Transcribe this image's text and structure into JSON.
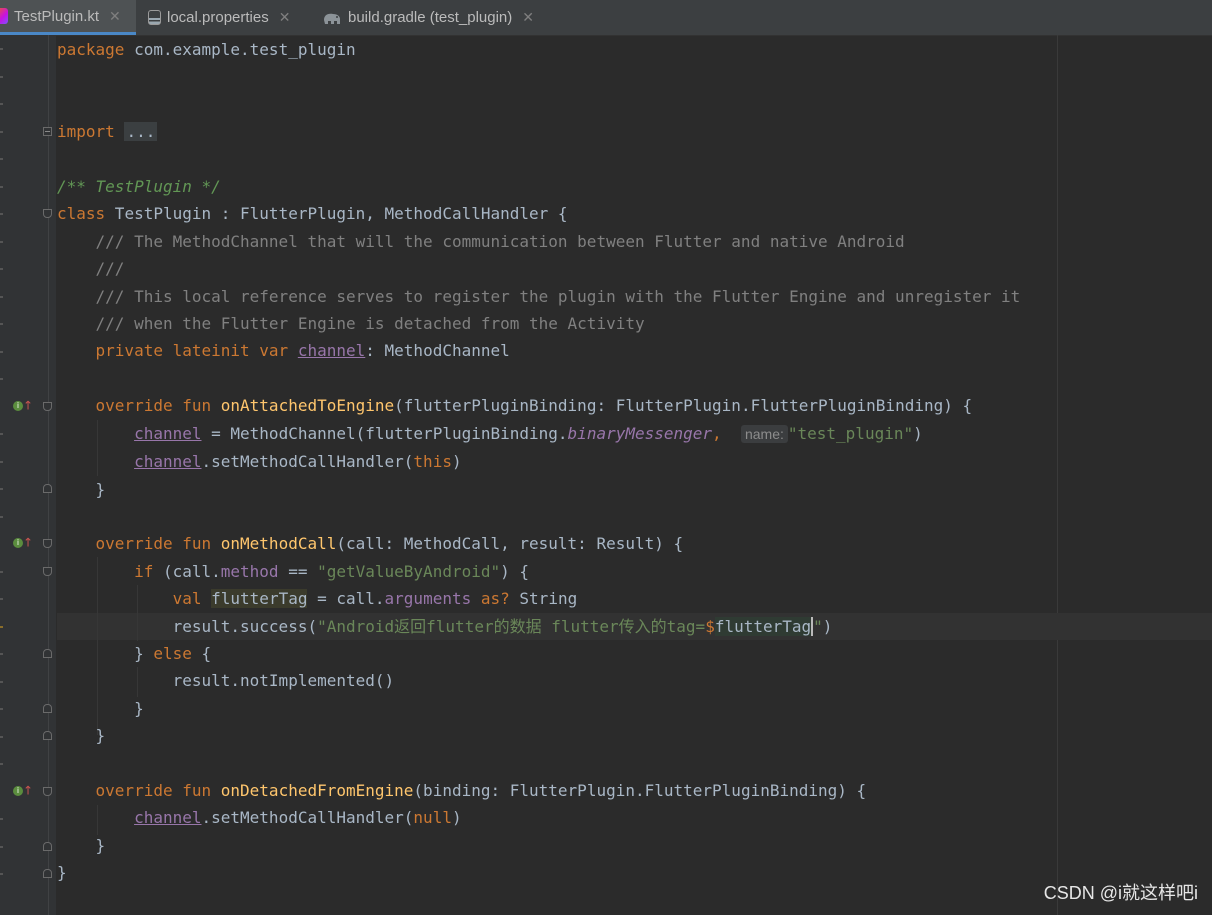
{
  "tabs": [
    {
      "label": "TestPlugin.kt",
      "icon": "kotlin-file-icon",
      "active": true
    },
    {
      "label": "local.properties",
      "icon": "properties-file-icon",
      "active": false
    },
    {
      "label": "build.gradle (test_plugin)",
      "icon": "gradle-elephant-icon",
      "active": false
    }
  ],
  "code": {
    "l1": {
      "kw": "package",
      "text": " com.example.test_plugin"
    },
    "l4": {
      "kw": "import",
      "dots": "..."
    },
    "l6": {
      "comment": "/** TestPlugin */"
    },
    "l7": {
      "kw": "class",
      "text": " TestPlugin : FlutterPlugin, MethodCallHandler {"
    },
    "l8": "    /// The MethodChannel that will the communication between Flutter and native Android",
    "l9": "    ///",
    "l10": "    /// This local reference serves to register the plugin with the Flutter Engine and unregister it",
    "l11": "    /// when the Flutter Engine is detached from the Activity",
    "l12": {
      "kw": "private lateinit var",
      "name": "channel",
      "type": ": MethodChannel"
    },
    "l14": {
      "kw": "override fun",
      "fn": "onAttachedToEngine",
      "rest": "(flutterPluginBinding: FlutterPlugin.FlutterPluginBinding) {"
    },
    "l15": {
      "name": "channel",
      "mid": " = MethodChannel(flutterPluginBinding.",
      "prop": "binaryMessenger",
      "comma": ",",
      "hint": "name:",
      "str": "\"test_plugin\"",
      "end": ")"
    },
    "l16": {
      "name": "channel",
      "mid": ".setMethodCallHandler(",
      "kw": "this",
      "end": ")"
    },
    "l17": "    }",
    "l19": {
      "kw": "override fun",
      "fn": "onMethodCall",
      "rest": "(call: MethodCall, result: Result) {"
    },
    "l20": {
      "kw": "if",
      "a": " (call.",
      "prop": "method",
      "b": " == ",
      "str": "\"getValueByAndroid\"",
      "end": ") {"
    },
    "l21": {
      "kw": "val",
      "var": "flutterTag",
      "a": " = call.",
      "prop": "arguments",
      "kw2": "as?",
      "end": " String"
    },
    "l22": {
      "a": "result.success(",
      "str": "\"Android返回flutter的数据 flutter传入的tag=",
      "dollar": "$",
      "tmpl": "flutterTag",
      "q": "\"",
      "end": ")"
    },
    "l23": {
      "a": "} ",
      "kw": "else",
      "end": " {"
    },
    "l24": "            result.notImplemented()",
    "l25": "        }",
    "l26": "    }",
    "l28": {
      "kw": "override fun",
      "fn": "onDetachedFromEngine",
      "rest": "(binding: FlutterPlugin.FlutterPluginBinding) {"
    },
    "l29": {
      "name": "channel",
      "mid": ".setMethodCallHandler(",
      "kw": "null",
      "end": ")"
    },
    "l30": "    }",
    "l31": "}"
  },
  "watermark": "CSDN @i就这样吧i",
  "colors": {
    "keyword": "#cc7832",
    "string": "#6a8759",
    "function": "#ffc66d",
    "property": "#9876aa",
    "comment": "#808080",
    "doc_comment": "#629755",
    "background": "#2b2b2b"
  }
}
